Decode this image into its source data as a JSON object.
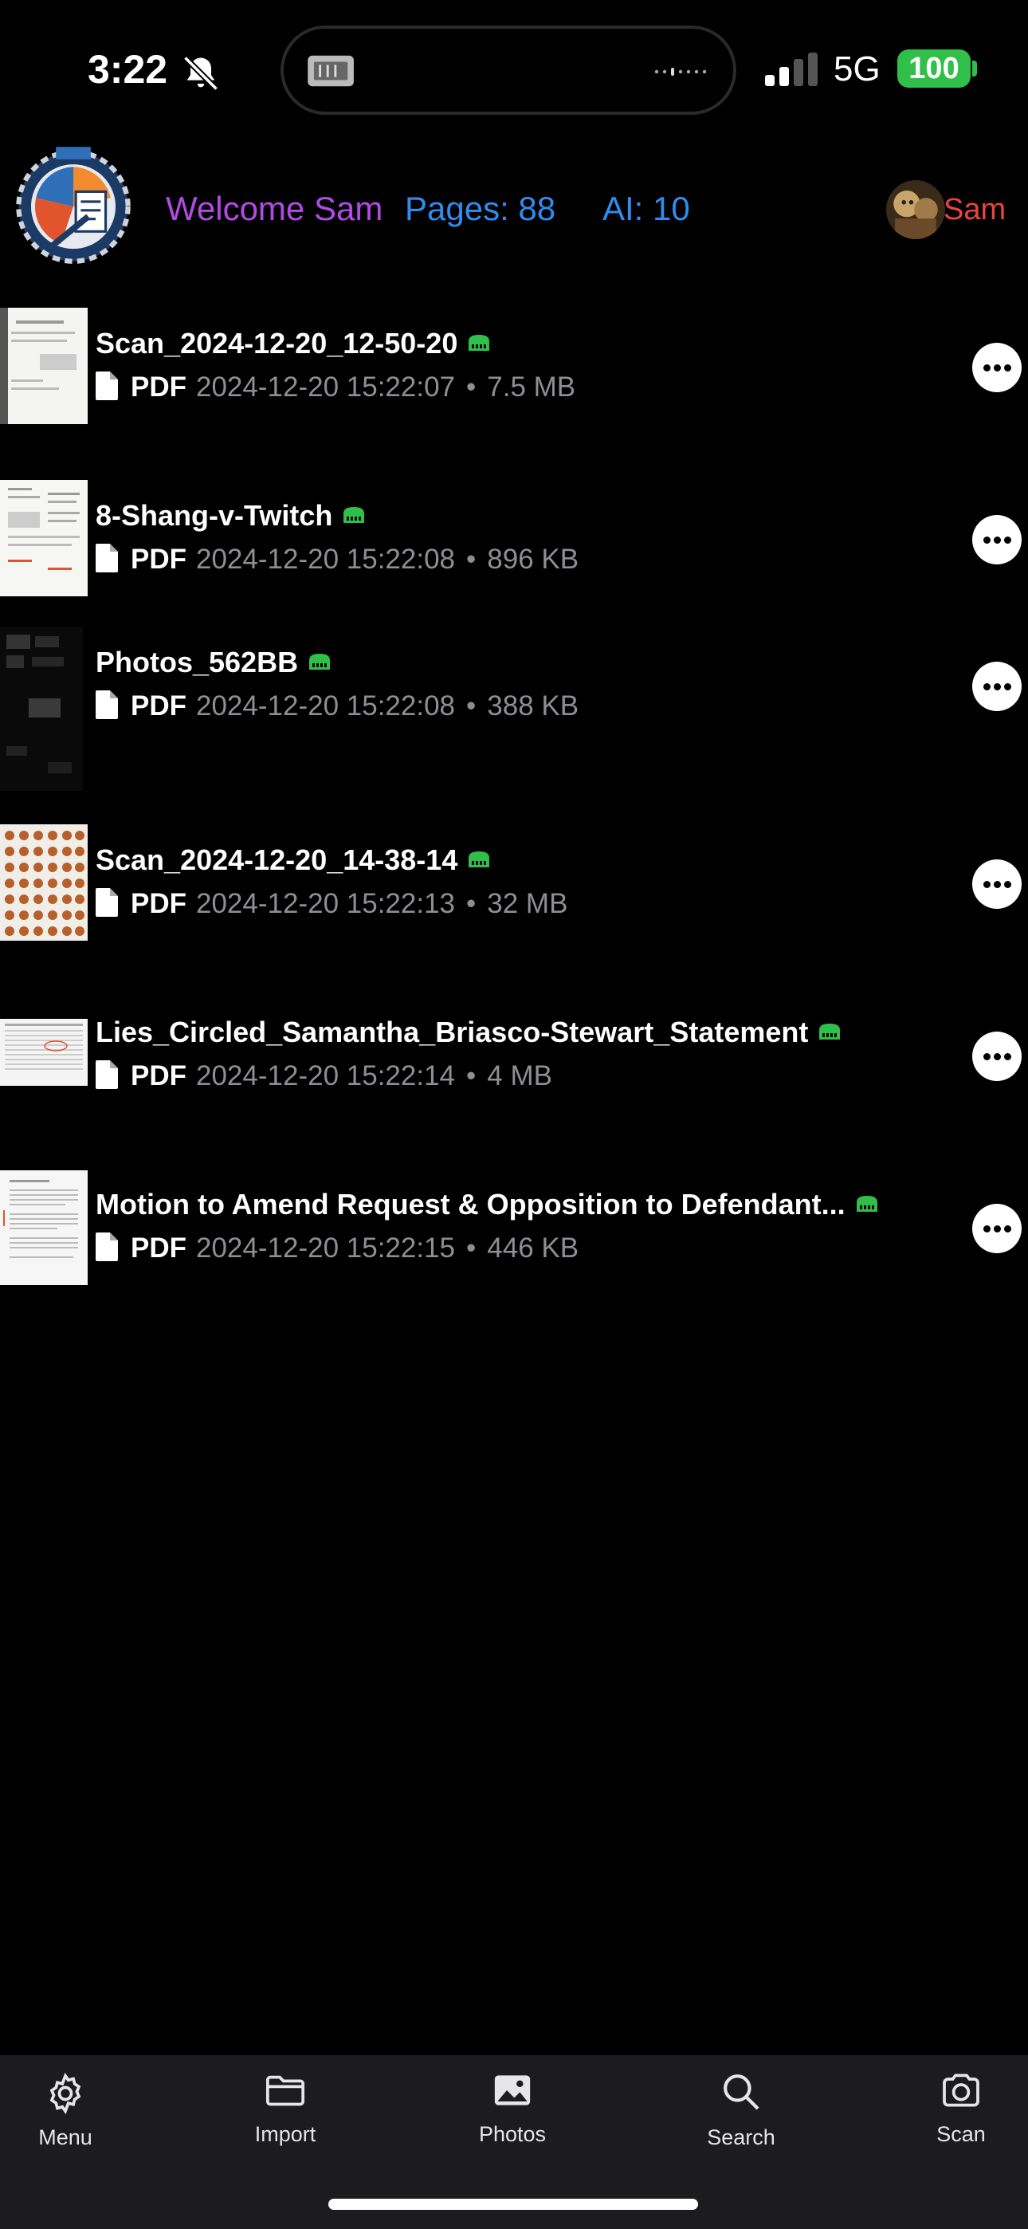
{
  "status_bar": {
    "time": "3:22",
    "network": "5G",
    "battery": "100",
    "silent_icon": "bell-slash-icon",
    "signal_icon": "cell-signal-icon"
  },
  "header": {
    "welcome": "Welcome Sam",
    "pages": "Pages: 88",
    "ai": "AI: 10",
    "user_name": "Sam",
    "colors": {
      "welcome": "#b24be6",
      "counts": "#2f8df0",
      "user": "#e8453c"
    }
  },
  "files": [
    {
      "name": "Scan_2024-12-20_12-50-20",
      "type": "PDF",
      "date": "2024-12-20 15:22:07",
      "dot": "•",
      "size": "7.5 MB"
    },
    {
      "name": "8-Shang-v-Twitch",
      "type": "PDF",
      "date": "2024-12-20 15:22:08",
      "dot": "•",
      "size": "896 KB"
    },
    {
      "name": "Photos_562BB",
      "type": "PDF",
      "date": "2024-12-20 15:22:08",
      "dot": "•",
      "size": "388 KB"
    },
    {
      "name": "Scan_2024-12-20_14-38-14",
      "type": "PDF",
      "date": "2024-12-20 15:22:13",
      "dot": "•",
      "size": "32 MB"
    },
    {
      "name": "Lies_Circled_Samantha_Briasco-Stewart_Statement",
      "type": "PDF",
      "date": "2024-12-20 15:22:14",
      "dot": "•",
      "size": "4 MB"
    },
    {
      "name": "Motion to Amend Request & Opposition to Defendant...",
      "type": "PDF",
      "date": "2024-12-20 15:22:15",
      "dot": "•",
      "size": "446 KB"
    }
  ],
  "tab_bar": {
    "menu": "Menu",
    "import": "Import",
    "photos": "Photos",
    "search": "Search",
    "scan": "Scan"
  },
  "colors": {
    "background": "#000000",
    "badge_green": "#30c04a",
    "meta_gray": "#8e8e93",
    "tab_bar_bg": "#1c1c1e"
  }
}
